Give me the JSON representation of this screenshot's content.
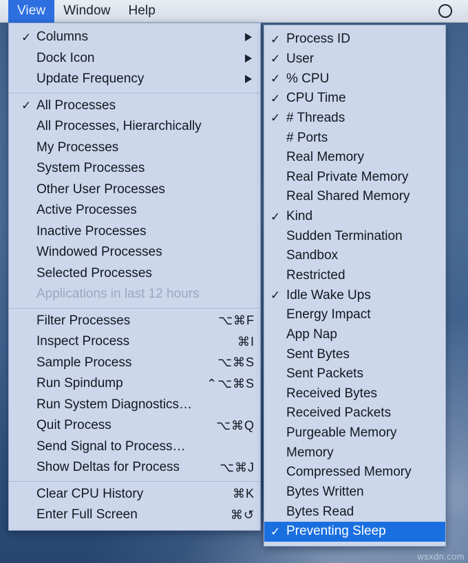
{
  "desktop": {
    "watermark": "wsxdn.com"
  },
  "menubar": {
    "items": [
      {
        "label": "View",
        "active": true
      },
      {
        "label": "Window",
        "active": false
      },
      {
        "label": "Help",
        "active": false
      }
    ],
    "status_icon": "siri-circle-icon"
  },
  "view_menu": {
    "groups": [
      {
        "items": [
          {
            "label": "Columns",
            "checked": true,
            "submenu": true,
            "shortcut": ""
          },
          {
            "label": "Dock Icon",
            "checked": false,
            "submenu": true,
            "shortcut": ""
          },
          {
            "label": "Update Frequency",
            "checked": false,
            "submenu": true,
            "shortcut": ""
          }
        ]
      },
      {
        "items": [
          {
            "label": "All Processes",
            "checked": true,
            "submenu": false,
            "shortcut": ""
          },
          {
            "label": "All Processes, Hierarchically",
            "checked": false,
            "submenu": false,
            "shortcut": ""
          },
          {
            "label": "My Processes",
            "checked": false,
            "submenu": false,
            "shortcut": ""
          },
          {
            "label": "System Processes",
            "checked": false,
            "submenu": false,
            "shortcut": ""
          },
          {
            "label": "Other User Processes",
            "checked": false,
            "submenu": false,
            "shortcut": ""
          },
          {
            "label": "Active Processes",
            "checked": false,
            "submenu": false,
            "shortcut": ""
          },
          {
            "label": "Inactive Processes",
            "checked": false,
            "submenu": false,
            "shortcut": ""
          },
          {
            "label": "Windowed Processes",
            "checked": false,
            "submenu": false,
            "shortcut": ""
          },
          {
            "label": "Selected Processes",
            "checked": false,
            "submenu": false,
            "shortcut": ""
          },
          {
            "label": "Applications in last 12 hours",
            "checked": false,
            "submenu": false,
            "shortcut": "",
            "disabled": true
          }
        ]
      },
      {
        "items": [
          {
            "label": "Filter Processes",
            "checked": false,
            "submenu": false,
            "shortcut": "⌥⌘F"
          },
          {
            "label": "Inspect Process",
            "checked": false,
            "submenu": false,
            "shortcut": "⌘I"
          },
          {
            "label": "Sample Process",
            "checked": false,
            "submenu": false,
            "shortcut": "⌥⌘S"
          },
          {
            "label": "Run Spindump",
            "checked": false,
            "submenu": false,
            "shortcut": "⌃⌥⌘S"
          },
          {
            "label": "Run System Diagnostics…",
            "checked": false,
            "submenu": false,
            "shortcut": ""
          },
          {
            "label": "Quit Process",
            "checked": false,
            "submenu": false,
            "shortcut": "⌥⌘Q"
          },
          {
            "label": "Send Signal to Process…",
            "checked": false,
            "submenu": false,
            "shortcut": ""
          },
          {
            "label": "Show Deltas for Process",
            "checked": false,
            "submenu": false,
            "shortcut": "⌥⌘J"
          }
        ]
      },
      {
        "items": [
          {
            "label": "Clear CPU History",
            "checked": false,
            "submenu": false,
            "shortcut": "⌘K"
          },
          {
            "label": "Enter Full Screen",
            "checked": false,
            "submenu": false,
            "shortcut": "⌘↺"
          }
        ]
      }
    ]
  },
  "columns_menu": {
    "items": [
      {
        "label": "Process ID",
        "checked": true,
        "selected": false
      },
      {
        "label": "User",
        "checked": true,
        "selected": false
      },
      {
        "label": "% CPU",
        "checked": true,
        "selected": false
      },
      {
        "label": "CPU Time",
        "checked": true,
        "selected": false
      },
      {
        "label": "# Threads",
        "checked": true,
        "selected": false
      },
      {
        "label": "# Ports",
        "checked": false,
        "selected": false
      },
      {
        "label": "Real Memory",
        "checked": false,
        "selected": false
      },
      {
        "label": "Real Private Memory",
        "checked": false,
        "selected": false
      },
      {
        "label": "Real Shared Memory",
        "checked": false,
        "selected": false
      },
      {
        "label": "Kind",
        "checked": true,
        "selected": false
      },
      {
        "label": "Sudden Termination",
        "checked": false,
        "selected": false
      },
      {
        "label": "Sandbox",
        "checked": false,
        "selected": false
      },
      {
        "label": "Restricted",
        "checked": false,
        "selected": false
      },
      {
        "label": "Idle Wake Ups",
        "checked": true,
        "selected": false
      },
      {
        "label": "Energy Impact",
        "checked": false,
        "selected": false
      },
      {
        "label": "App Nap",
        "checked": false,
        "selected": false
      },
      {
        "label": "Sent Bytes",
        "checked": false,
        "selected": false
      },
      {
        "label": "Sent Packets",
        "checked": false,
        "selected": false
      },
      {
        "label": "Received Bytes",
        "checked": false,
        "selected": false
      },
      {
        "label": "Received Packets",
        "checked": false,
        "selected": false
      },
      {
        "label": "Purgeable Memory",
        "checked": false,
        "selected": false
      },
      {
        "label": "Memory",
        "checked": false,
        "selected": false
      },
      {
        "label": "Compressed Memory",
        "checked": false,
        "selected": false
      },
      {
        "label": "Bytes Written",
        "checked": false,
        "selected": false
      },
      {
        "label": "Bytes Read",
        "checked": false,
        "selected": false
      },
      {
        "label": "Preventing Sleep",
        "checked": true,
        "selected": true
      }
    ]
  },
  "glyphs": {
    "check": "✓"
  },
  "colors": {
    "highlight": "#1a6fe0",
    "menu_bg": "#ccd7ec",
    "menubar_bg": "#e3e8f0",
    "text": "#111820",
    "disabled_text": "#9aa7bd"
  }
}
